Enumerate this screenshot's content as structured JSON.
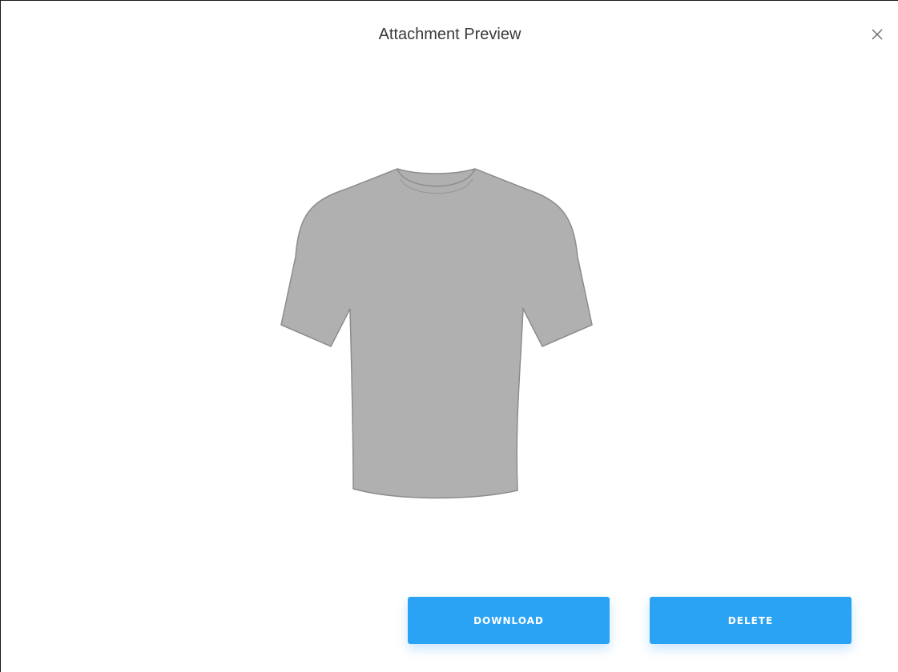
{
  "modal": {
    "title": "Attachment Preview",
    "close_icon": "close-icon",
    "preview_icon": "tshirt-image"
  },
  "actions": {
    "download_label": "DOWNLOAD",
    "delete_label": "DELETE"
  },
  "colors": {
    "button_primary": "#2ba3f5",
    "shirt_fill": "#b0b0b0",
    "shirt_outline": "#8c8c8c",
    "title_text": "#3a3a3a"
  }
}
